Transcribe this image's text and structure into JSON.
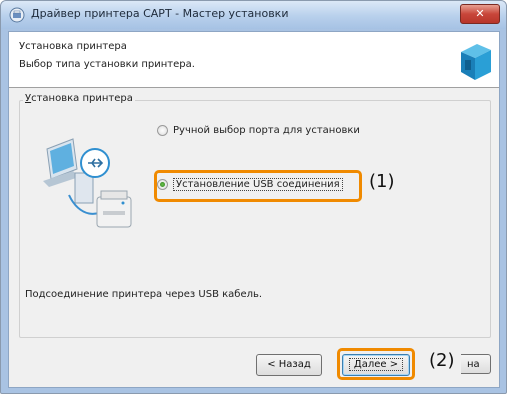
{
  "window": {
    "title": "Драйвер принтера CAPT - Мастер установки",
    "close_label": "✕"
  },
  "header": {
    "title": "Установка принтера",
    "subtitle": "Выбор типа установки принтера."
  },
  "group": {
    "label_accel": "У",
    "label_rest": "становка принтера"
  },
  "options": [
    {
      "label": "Ручной выбор порта для установки",
      "checked": false
    },
    {
      "label": "Установление USB соединения",
      "checked": true
    }
  ],
  "description": "Подсоединение принтера через USB кабель.",
  "buttons": {
    "back_label": "< Назад",
    "next_label": "Далее >",
    "cancel_partial": "на"
  },
  "callouts": {
    "one": "(1)",
    "two": "(2)"
  },
  "colors": {
    "highlight": "#f08a00",
    "titlebar": "#b8d0ec"
  },
  "icons": [
    "printer-app-icon",
    "printer-box-icon",
    "computer-usb-printer-illustration"
  ]
}
